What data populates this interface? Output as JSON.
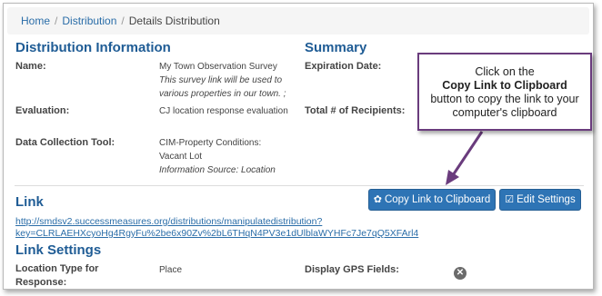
{
  "breadcrumb": {
    "home": "Home",
    "separator": "/",
    "distribution": "Distribution",
    "current": "Details Distribution"
  },
  "info": {
    "title": "Distribution Information",
    "name_label": "Name:",
    "name_value_line1": "My Town Observation Survey",
    "name_value_line2": "This survey link will be used to",
    "name_value_line3": "various properties in our town. ;",
    "evaluation_label": "Evaluation:",
    "evaluation_value": "CJ location response evaluation",
    "tool_label": "Data Collection Tool:",
    "tool_value_line1": "CIM-Property Conditions:",
    "tool_value_line2": "Vacant Lot",
    "tool_value_line3": "Information Source: Location"
  },
  "summary": {
    "title": "Summary",
    "expiration_label": "Expiration Date:",
    "recipients_label": "Total # of Recipients:"
  },
  "link_section": {
    "title": "Link",
    "copy_button": "Copy Link to Clipboard",
    "edit_button": "Edit Settings",
    "url_line1": "http://smdsv2.successmeasures.org/distributions/manipulatedistribution?",
    "url_line2": "key=CLRLAEHXcyoHg4RgyFu%2be6x90Zv%2bL6THqN4PV3e1dUlblaWYHFc7Je7qQ5XFArl4"
  },
  "settings": {
    "title": "Link Settings",
    "location_label_line1": "Location Type for",
    "location_label_line2": "Response:",
    "location_value": "Place",
    "gps_label": "Display GPS Fields:",
    "gps_value_icon": "x-circle-icon"
  },
  "callout": {
    "line1": "Click on the",
    "line2": "Copy Link to Clipboard",
    "line3": "button to copy the link to your",
    "line4": "computer's clipboard"
  },
  "colors": {
    "heading": "#1f5c95",
    "button": "#2e74b5",
    "link": "#2a6da8",
    "callout_border": "#6a3c7d"
  }
}
